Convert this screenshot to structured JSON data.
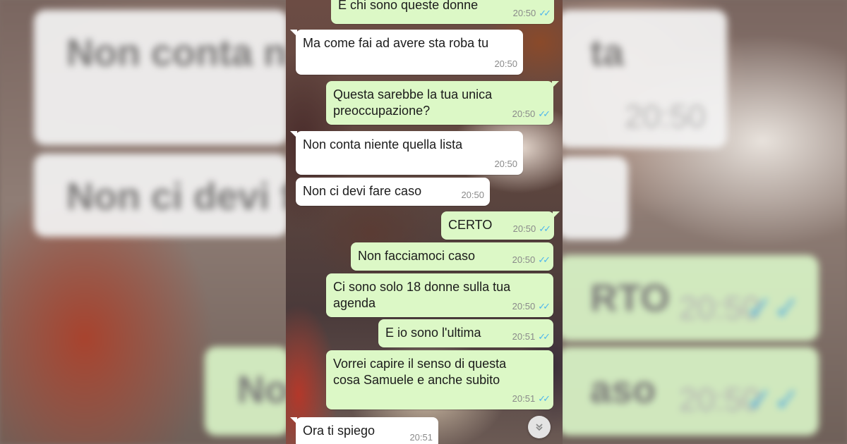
{
  "messages": [
    {
      "dir": "out",
      "text": "E chi sono queste donne",
      "time": "20:50",
      "read": true
    },
    {
      "dir": "in",
      "text": "Ma come fai ad avere sta roba tu",
      "time": "20:50"
    },
    {
      "dir": "out",
      "text": "Questa sarebbe la tua unica\npreoccupazione?",
      "time": "20:50",
      "read": true
    },
    {
      "dir": "in",
      "text": "Non conta niente quella lista",
      "time": "20:50"
    },
    {
      "dir": "in",
      "text": "Non ci devi fare caso",
      "time": "20:50"
    },
    {
      "dir": "out",
      "text": "CERTO",
      "time": "20:50",
      "read": true
    },
    {
      "dir": "out",
      "text": "Non facciamoci caso",
      "time": "20:50",
      "read": true
    },
    {
      "dir": "out",
      "text": "Ci sono solo 18 donne sulla tua\nagenda",
      "time": "20:50",
      "read": true
    },
    {
      "dir": "out",
      "text": "E io sono l'ultima",
      "time": "20:51",
      "read": true
    },
    {
      "dir": "out",
      "text": "Vorrei capire il senso di questa\ncosa Samuele e anche subito",
      "time": "20:51",
      "read": true
    },
    {
      "dir": "in",
      "text": "Ora ti spiego",
      "time": "20:51"
    }
  ],
  "background_fragments": {
    "text_1": "Non conta n",
    "text_2": "ta",
    "text_3": "Non ci devi f",
    "text_4": "RTO",
    "text_5": "No",
    "text_6": "aso",
    "time": "20:50"
  },
  "icons": {
    "read_receipt": "double-check-icon",
    "scroll": "chevron-double-down-icon"
  },
  "colors": {
    "incoming_bubble": "#ffffff",
    "outgoing_bubble": "#dcf8c6",
    "read_tick": "#4fb6ec"
  }
}
